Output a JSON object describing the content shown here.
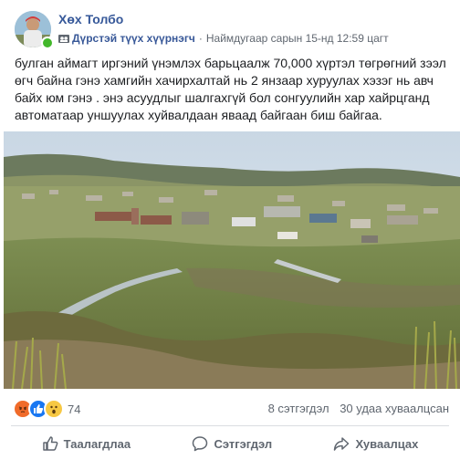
{
  "post": {
    "author": "Хөх Толбо",
    "group": "Дүрстэй түүх хүүрнэгч",
    "timestamp": "Наймдугаар сарын 15-нд 12:59 цагт",
    "separator": "·",
    "text": "булган аймагт иргэний үнэмлэх барьцаалж 70,000 хүртэл төгрөгний зээл өгч байна гэнэ хамгийн хачирхалтай нь 2 янзаар хуруулах хэзэг нь авч байх юм гэнэ . энэ асуудлыг шалгахгүй бол сонгуулийн хар хайрцганд автоматаар уншуулах хуйвалдаан яваад байгаан биш байгаа.",
    "photo_icon": "landscape-photo-valley-town"
  },
  "reactions": {
    "icons": [
      "angry",
      "like",
      "wow"
    ],
    "count": "74"
  },
  "stats": {
    "comments": "8 сэтгэгдэл",
    "shares": "30 удаа хуваалцсан"
  },
  "actions": {
    "like": "Таалагдлаа",
    "comment": "Сэтгэгдэл",
    "share": "Хуваалцах"
  },
  "colors": {
    "link": "#365899",
    "muted": "#606770",
    "like_blue": "#1877f2",
    "angry_orange": "#f06b2a",
    "wow_yellow": "#f7c843"
  }
}
